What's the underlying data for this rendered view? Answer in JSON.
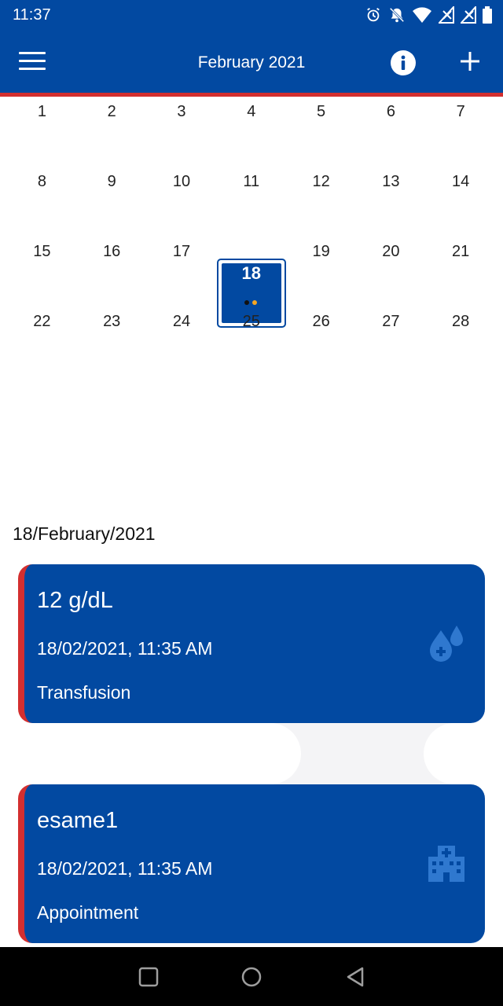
{
  "status_bar": {
    "time": "11:37",
    "icons": [
      "alarm-icon",
      "notifications-off-icon",
      "wifi-icon",
      "no-sim-icon",
      "no-sim-icon",
      "battery-icon"
    ]
  },
  "app_bar": {
    "menu_icon": "menu-icon",
    "title": "February 2021",
    "info_icon": "info-icon",
    "add_icon": "add-icon"
  },
  "calendar": {
    "weeks": [
      [
        "1",
        "2",
        "3",
        "4",
        "5",
        "6",
        "7"
      ],
      [
        "8",
        "9",
        "10",
        "11",
        "12",
        "13",
        "14"
      ],
      [
        "15",
        "16",
        "17",
        "18",
        "19",
        "20",
        "21"
      ],
      [
        "22",
        "23",
        "24",
        "25",
        "26",
        "27",
        "28"
      ]
    ],
    "selected_day": "18",
    "selected_day_event_dots": [
      "#111111",
      "#f5a623"
    ]
  },
  "selected_date_heading": "18/February/2021",
  "events": [
    {
      "value": "12 g/dL",
      "datetime": "18/02/2021, 11:35 AM",
      "type": "Transfusion",
      "icon": "blood-drops-icon"
    },
    {
      "value": "esame1",
      "datetime": "18/02/2021, 11:35 AM",
      "type": "Appointment",
      "icon": "hospital-icon"
    }
  ],
  "nav_bar": {
    "icons": [
      "recent-apps-icon",
      "home-icon",
      "back-icon"
    ]
  },
  "colors": {
    "primary": "#0249a1",
    "accent": "#d32f2f",
    "card_icon": "#2f78cf"
  }
}
